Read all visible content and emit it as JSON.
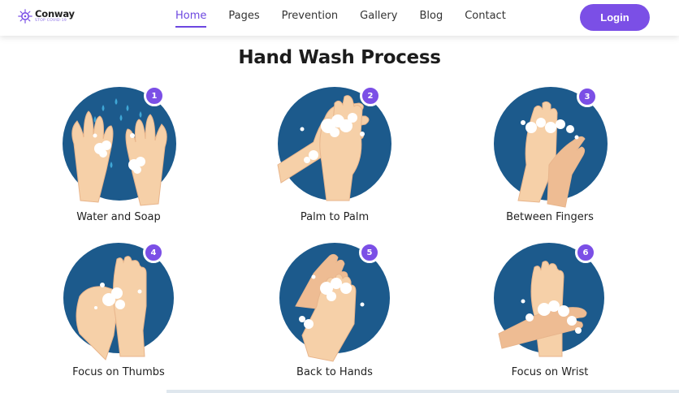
{
  "logo": {
    "name": "Conway",
    "tagline": "STOP COVID-19"
  },
  "nav": {
    "items": [
      {
        "label": "Home",
        "active": true
      },
      {
        "label": "Pages",
        "active": false
      },
      {
        "label": "Prevention",
        "active": false
      },
      {
        "label": "Gallery",
        "active": false
      },
      {
        "label": "Blog",
        "active": false
      },
      {
        "label": "Contact",
        "active": false
      }
    ],
    "login_label": "Login"
  },
  "section": {
    "title": "Hand Wash Process"
  },
  "steps": [
    {
      "number": "1",
      "label": "Water and Soap"
    },
    {
      "number": "2",
      "label": "Palm to Palm"
    },
    {
      "number": "3",
      "label": "Between Fingers"
    },
    {
      "number": "4",
      "label": "Focus on Thumbs"
    },
    {
      "number": "5",
      "label": "Back to Hands"
    },
    {
      "number": "6",
      "label": "Focus on Wrist"
    }
  ],
  "colors": {
    "accent": "#7b4fe6",
    "circle": "#1c5a8c",
    "skin": "#f6d0a8",
    "skin_shadow": "#e8b58c",
    "foam": "#ffffff",
    "water": "#3fa7d6"
  },
  "icons": [
    "virus-logo-icon",
    "hands-washing-illustration"
  ]
}
